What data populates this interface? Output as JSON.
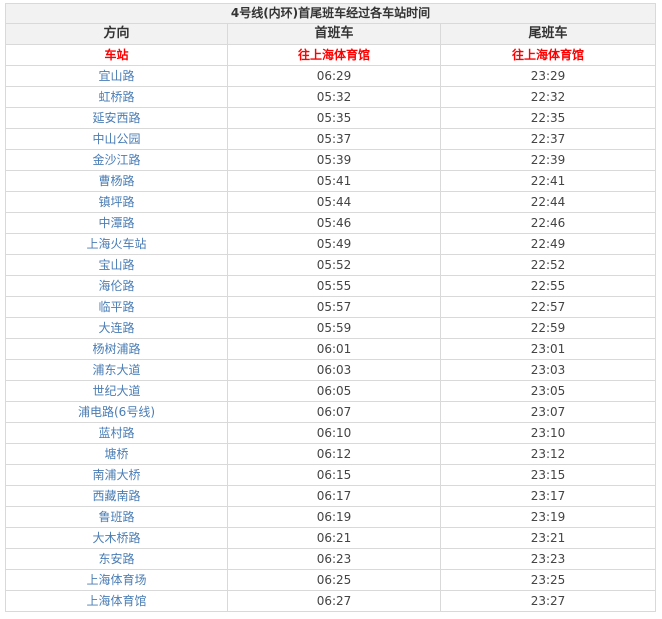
{
  "table": {
    "title": "4号线(内环)首尾班车经过各车站时间",
    "headers": [
      "方向",
      "首班车",
      "尾班车"
    ],
    "subheaders": [
      "车站",
      "往上海体育馆",
      "往上海体育馆"
    ],
    "rows": [
      [
        "宜山路",
        "06:29",
        "23:29"
      ],
      [
        "虹桥路",
        "05:32",
        "22:32"
      ],
      [
        "延安西路",
        "05:35",
        "22:35"
      ],
      [
        "中山公园",
        "05:37",
        "22:37"
      ],
      [
        "金沙江路",
        "05:39",
        "22:39"
      ],
      [
        "曹杨路",
        "05:41",
        "22:41"
      ],
      [
        "镇坪路",
        "05:44",
        "22:44"
      ],
      [
        "中潭路",
        "05:46",
        "22:46"
      ],
      [
        "上海火车站",
        "05:49",
        "22:49"
      ],
      [
        "宝山路",
        "05:52",
        "22:52"
      ],
      [
        "海伦路",
        "05:55",
        "22:55"
      ],
      [
        "临平路",
        "05:57",
        "22:57"
      ],
      [
        "大连路",
        "05:59",
        "22:59"
      ],
      [
        "杨树浦路",
        "06:01",
        "23:01"
      ],
      [
        "浦东大道",
        "06:03",
        "23:03"
      ],
      [
        "世纪大道",
        "06:05",
        "23:05"
      ],
      [
        "浦电路(6号线)",
        "06:07",
        "23:07"
      ],
      [
        "蓝村路",
        "06:10",
        "23:10"
      ],
      [
        "塘桥",
        "06:12",
        "23:12"
      ],
      [
        "南浦大桥",
        "06:15",
        "23:15"
      ],
      [
        "西藏南路",
        "06:17",
        "23:17"
      ],
      [
        "鲁班路",
        "06:19",
        "23:19"
      ],
      [
        "大木桥路",
        "06:21",
        "23:21"
      ],
      [
        "东安路",
        "06:23",
        "23:23"
      ],
      [
        "上海体育场",
        "06:25",
        "23:25"
      ],
      [
        "上海体育馆",
        "06:27",
        "23:27"
      ]
    ]
  },
  "colors": {
    "header_bg": "#f2f2f2",
    "border": "#d9d9d9",
    "subheader_text": "#ff0000",
    "station_text": "#4a7db5"
  }
}
